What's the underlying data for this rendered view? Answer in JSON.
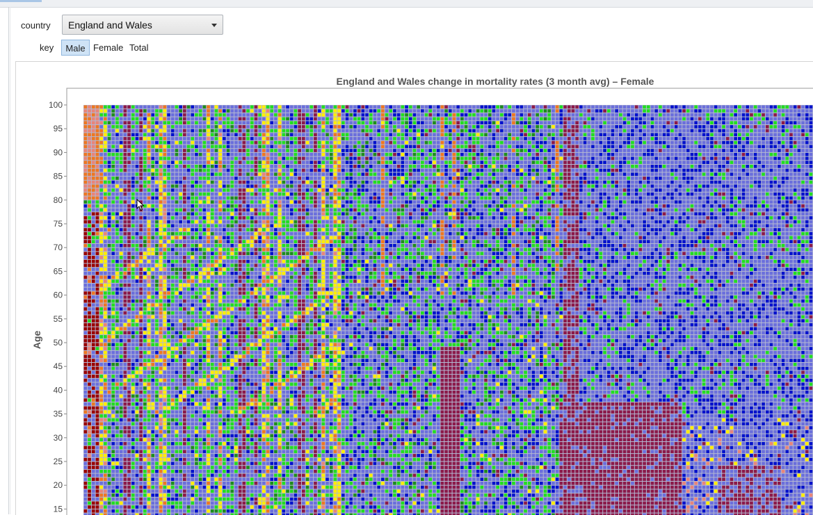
{
  "controls": {
    "country_label": "country",
    "country_value": "England and Wales",
    "key_label": "key",
    "key_options": [
      "Male",
      "Female",
      "Total"
    ],
    "key_selected": "Male"
  },
  "chart_data": {
    "type": "heatmap",
    "title": "England and Wales change in mortality rates (3 month avg) – Female",
    "ylabel": "Age",
    "xlabel": "",
    "y_ticks": [
      100,
      95,
      90,
      85,
      80,
      75,
      70,
      65,
      60,
      55,
      50,
      45,
      40,
      35,
      30,
      25,
      20,
      15
    ],
    "ylim": [
      10,
      100
    ],
    "grid": true,
    "palette": {
      "light_blue": "#6b6fdc",
      "blue": "#0011cc",
      "green": "#22dd22",
      "dark_green": "#1e8c1e",
      "yellow": "#ffee00",
      "orange": "#ee7722",
      "pink": "#e8857a",
      "dark_red": "#990000",
      "maroon": "#8b1a4a",
      "grid": "#b4b8d2"
    }
  }
}
